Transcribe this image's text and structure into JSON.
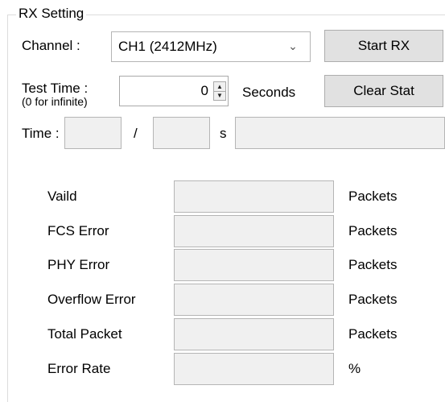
{
  "group": {
    "title": "RX Setting"
  },
  "channel": {
    "label": "Channel :",
    "selected": "CH1 (2412MHz)"
  },
  "buttons": {
    "start_rx": "Start RX",
    "clear_stat": "Clear Stat"
  },
  "test_time": {
    "label": "Test Time :",
    "hint": "(0 for infinite)",
    "value": "0",
    "unit": "Seconds"
  },
  "time_row": {
    "label": "Time :",
    "separator": "/",
    "unit": "s",
    "elapsed": "",
    "total": "",
    "status": ""
  },
  "stats": [
    {
      "label": "Vaild",
      "value": "",
      "unit": "Packets"
    },
    {
      "label": "FCS Error",
      "value": "",
      "unit": "Packets"
    },
    {
      "label": "PHY Error",
      "value": "",
      "unit": "Packets"
    },
    {
      "label": "Overflow Error",
      "value": "",
      "unit": "Packets"
    },
    {
      "label": "Total Packet",
      "value": "",
      "unit": "Packets"
    },
    {
      "label": "Error Rate",
      "value": "",
      "unit": "%"
    }
  ]
}
